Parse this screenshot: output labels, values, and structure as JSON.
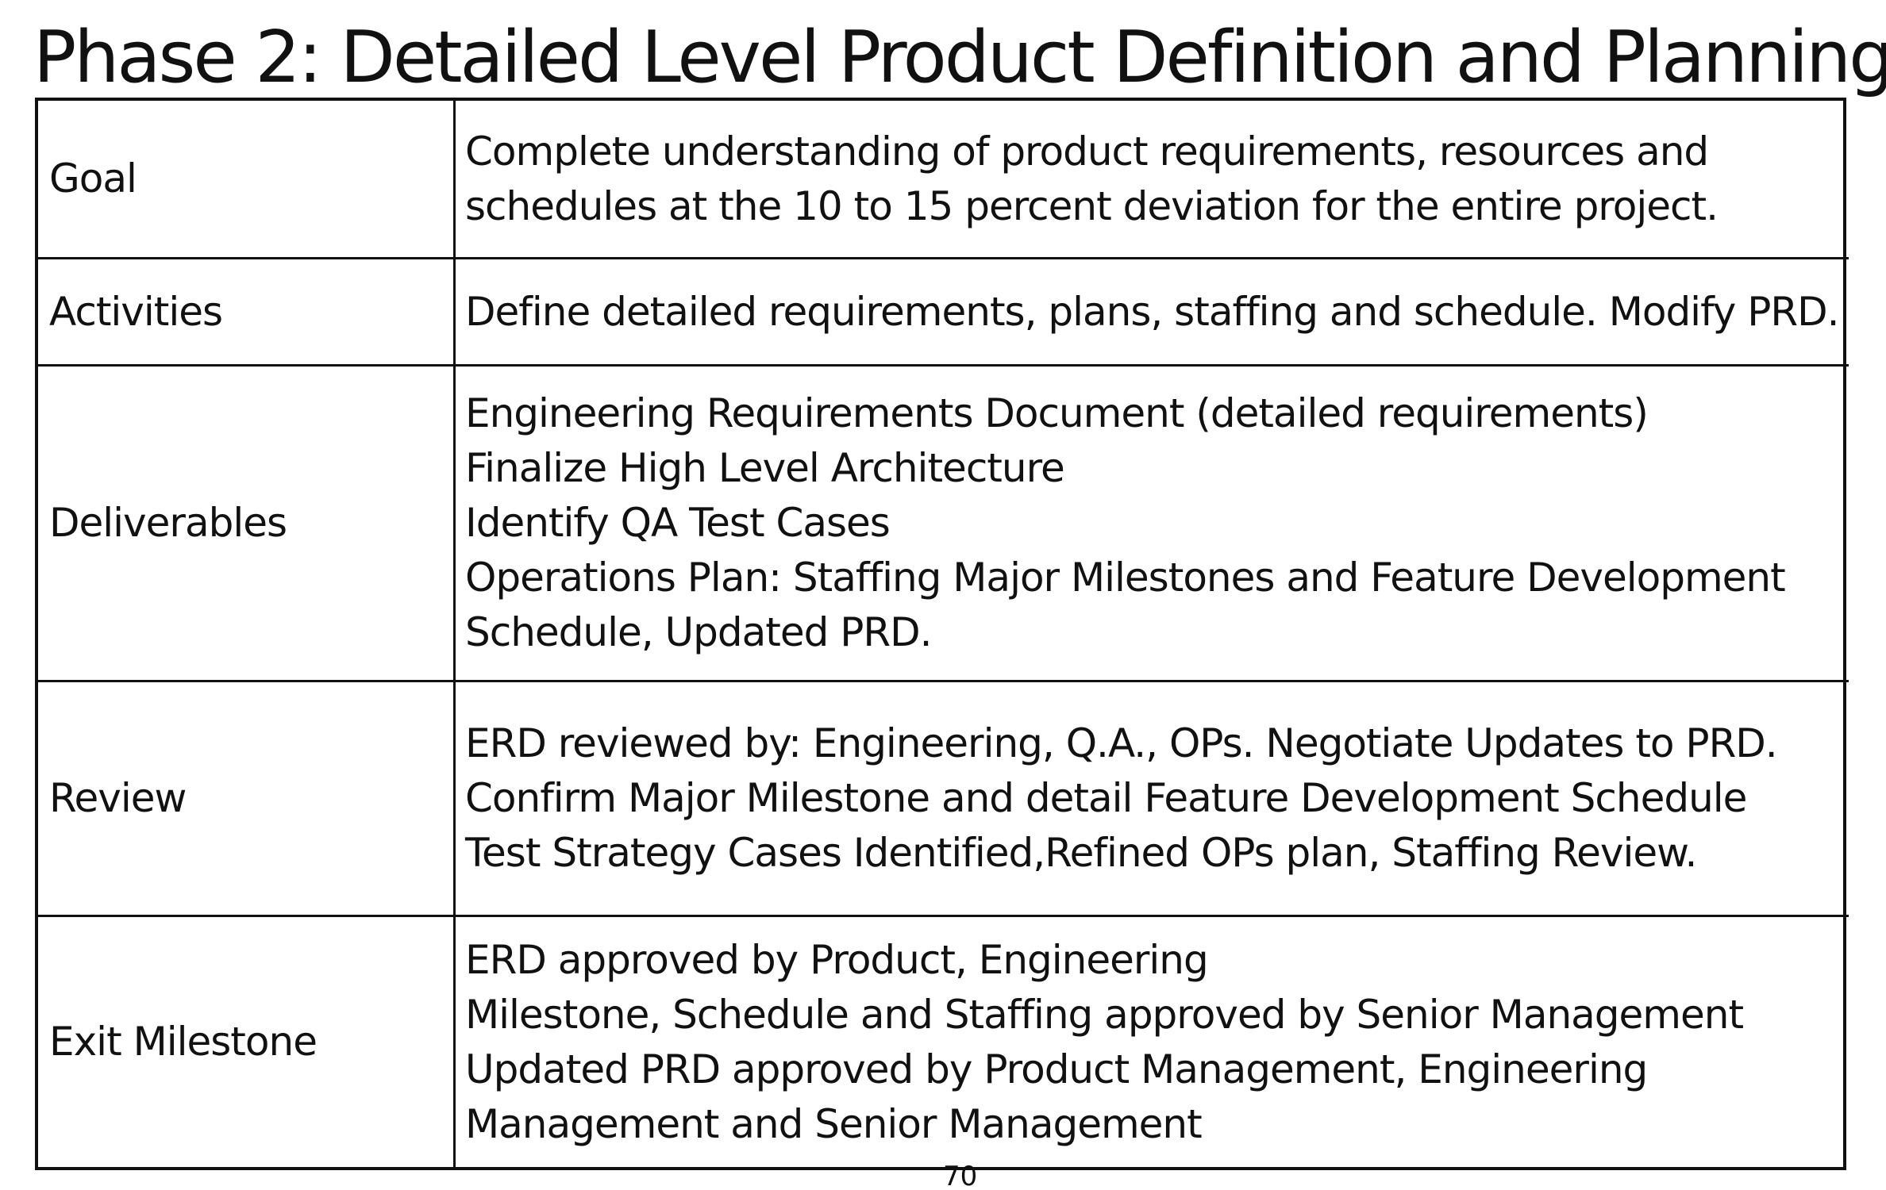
{
  "title": "Phase 2: Detailed Level Product Definition and Planning",
  "rows": [
    {
      "label": "Goal",
      "lines": [
        "Complete understanding of product requirements, resources and",
        "schedules at the 10 to 15 percent deviation for the entire project."
      ]
    },
    {
      "label": "Activities",
      "lines": [
        "Define detailed requirements, plans, staffing and schedule.  Modify PRD."
      ]
    },
    {
      "label": "Deliverables",
      "lines": [
        "Engineering Requirements Document (detailed requirements)",
        "Finalize High Level Architecture",
        "Identify QA Test Cases",
        "Operations Plan: Staffing Major Milestones and Feature Development",
        "Schedule, Updated PRD."
      ]
    },
    {
      "label": "Review",
      "lines": [
        "ERD reviewed by: Engineering, Q.A., OPs. Negotiate Updates to PRD.",
        "Confirm Major Milestone and detail Feature Development Schedule",
        "Test Strategy Cases Identified,Refined OPs plan, Staffing Review."
      ]
    },
    {
      "label": "Exit Milestone",
      "lines": [
        "ERD approved by Product, Engineering",
        "Milestone, Schedule and Staffing approved by Senior Management",
        "Updated PRD approved by Product Management, Engineering",
        "Management and Senior Management"
      ]
    }
  ],
  "page_number": "70"
}
